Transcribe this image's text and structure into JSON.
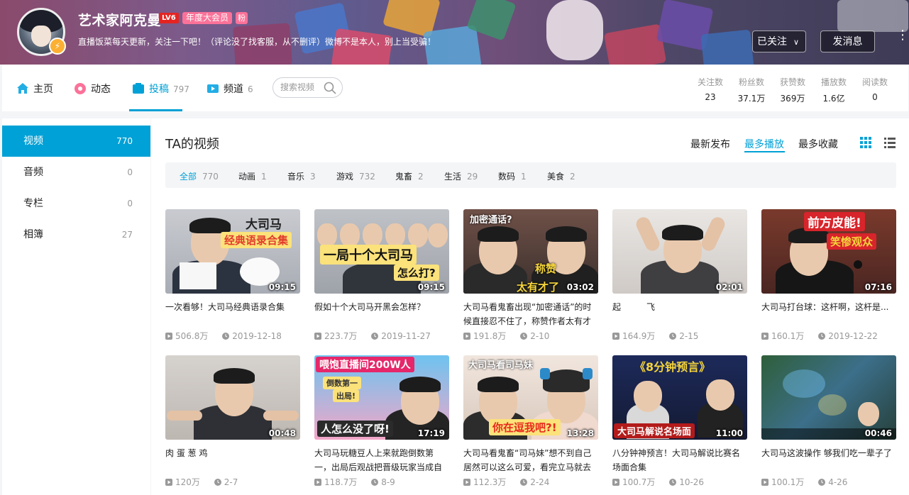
{
  "profile": {
    "username": "艺术家阿克曼",
    "level": "LV6",
    "vip": "年度大会员",
    "fan_badge": "粉",
    "sign": "直播饭菜每天更新，关注一下吧！（评论没了找客服，从不删评）微博不是本人，别上当受骗！",
    "follow_label": "已关注",
    "message_label": "发消息"
  },
  "nav": {
    "home": "主页",
    "dynamic": "动态",
    "contribute": "投稿",
    "contribute_count": "797",
    "channel": "频道",
    "channel_count": "6",
    "search_placeholder": "搜索视频"
  },
  "stats": [
    {
      "label": "关注数",
      "value": "23"
    },
    {
      "label": "粉丝数",
      "value": "37.1万"
    },
    {
      "label": "获赞数",
      "value": "369万"
    },
    {
      "label": "播放数",
      "value": "1.6亿"
    },
    {
      "label": "阅读数",
      "value": "0"
    }
  ],
  "sidebar": [
    {
      "label": "视频",
      "count": "770"
    },
    {
      "label": "音频",
      "count": "0"
    },
    {
      "label": "专栏",
      "count": "0"
    },
    {
      "label": "相簿",
      "count": "27"
    }
  ],
  "main": {
    "title": "TA的视频",
    "sort": [
      "最新发布",
      "最多播放",
      "最多收藏"
    ],
    "filters": [
      {
        "label": "全部",
        "count": "770"
      },
      {
        "label": "动画",
        "count": "1"
      },
      {
        "label": "音乐",
        "count": "3"
      },
      {
        "label": "游戏",
        "count": "732"
      },
      {
        "label": "鬼畜",
        "count": "2"
      },
      {
        "label": "生活",
        "count": "29"
      },
      {
        "label": "数码",
        "count": "1"
      },
      {
        "label": "美食",
        "count": "2"
      }
    ]
  },
  "videos": [
    {
      "title": "一次看够！大司马经典语录合集",
      "duration": "09:15",
      "plays": "506.8万",
      "date": "2019-12-18",
      "thumb_text": "大司马",
      "thumb_text2": "经典语录合集"
    },
    {
      "title": "假如十个大司马开黑会怎样？",
      "duration": "09:15",
      "plays": "223.7万",
      "date": "2019-11-27",
      "thumb_text": "一局十个大司马",
      "thumb_text2": "怎么打?"
    },
    {
      "title": "大司马看鬼畜出现“加密通话”的时候直接忍不住了，称赞作者太有才",
      "duration": "03:02",
      "plays": "191.8万",
      "date": "2-10",
      "thumb_text": "加密通话?",
      "thumb_text2": "称赞",
      "thumb_text3": "太有才了"
    },
    {
      "title": "起　　　飞",
      "duration": "02:01",
      "plays": "164.9万",
      "date": "2-15"
    },
    {
      "title": "大司马打台球：这杆啊，这杆是...",
      "duration": "07:16",
      "plays": "160.1万",
      "date": "2019-12-22",
      "thumb_text": "前方皮能!",
      "thumb_text2": "笑惨观众"
    },
    {
      "title": "肉 蛋 葱 鸡",
      "duration": "00:48",
      "plays": "120万",
      "date": "2-7"
    },
    {
      "title": "大司马玩糖豆人上来就跑倒数第一，出局后观战把晋级玩家当成自",
      "duration": "17:19",
      "plays": "118.7万",
      "date": "8-9",
      "thumb_text": "喂饱直播间200W人",
      "thumb_text2": "倒数第一",
      "thumb_text3": "出局!",
      "thumb_text4": "人怎么没了呀!"
    },
    {
      "title": "大司马看鬼畜“司马妹”想不到自己居然可以这么可爱，看完立马就去",
      "duration": "13:28",
      "plays": "112.3万",
      "date": "2-24",
      "thumb_text": "大司马看司马妹",
      "thumb_text2": "你在逗我吧?!"
    },
    {
      "title": "八分钟神预言！大司马解说比赛名场面合集",
      "duration": "11:00",
      "plays": "100.7万",
      "date": "10-26",
      "thumb_text": "《8分钟预言》",
      "thumb_text2": "大司马解说名场面"
    },
    {
      "title": "大司马这波操作 够我们吃一辈子了",
      "duration": "00:46",
      "plays": "100.1万",
      "date": "4-26"
    }
  ],
  "colors": {
    "accent": "#00a1d6",
    "pink": "#fb7299"
  }
}
